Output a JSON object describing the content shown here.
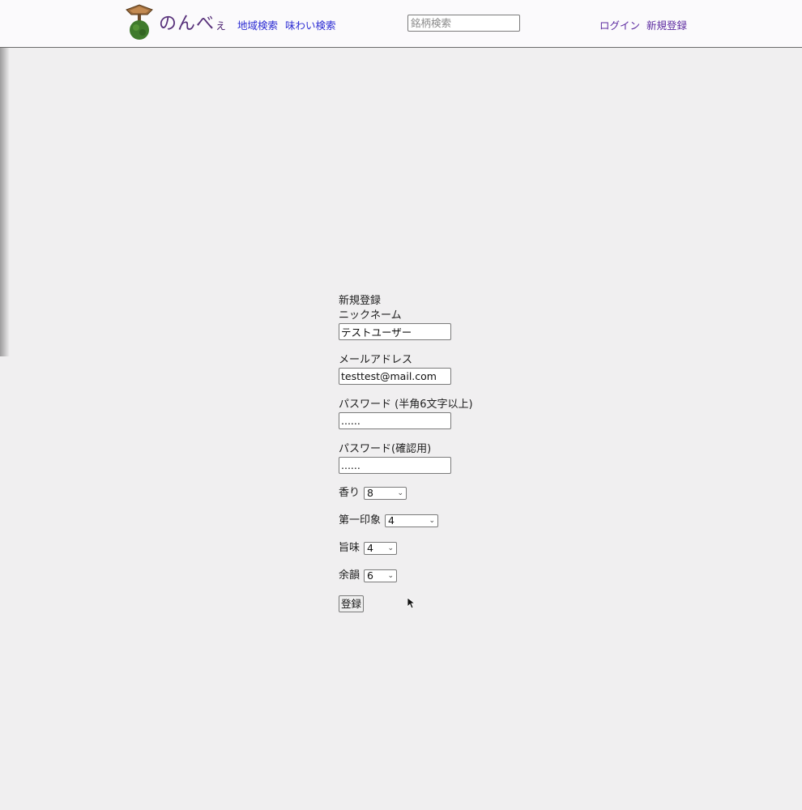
{
  "header": {
    "brand_main": "のんべ",
    "brand_small": "ぇ",
    "nav": [
      "地域検索",
      "味わい検索"
    ],
    "search_placeholder": "銘柄検索",
    "auth": [
      "ログイン",
      "新規登録"
    ]
  },
  "form": {
    "title": "新規登録",
    "nickname_label": "ニックネーム",
    "nickname_value": "テストユーザー",
    "email_label": "メールアドレス",
    "email_value": "testtest@mail.com",
    "password_label": "パスワード (半角6文字以上)",
    "password_value": "......",
    "password_confirm_label": "パスワード(確認用)",
    "password_confirm_value": "......",
    "aroma_label": "香り",
    "aroma_value": "8",
    "first_impression_label": "第一印象",
    "first_impression_value": "4",
    "umami_label": "旨味",
    "umami_value": "4",
    "finish_label": "余韻",
    "finish_value": "6",
    "submit_label": "登録"
  },
  "colors": {
    "background": "#f0eff0",
    "header_bg": "#fbfafc",
    "brand": "#57307a",
    "link": "#2b2bd3",
    "visited_link": "#5c2aa0"
  },
  "icons": {
    "logo": "sake-barrel-bonsai-logo",
    "select_arrow": "chevron-down-icon",
    "cursor": "mouse-pointer-icon"
  }
}
